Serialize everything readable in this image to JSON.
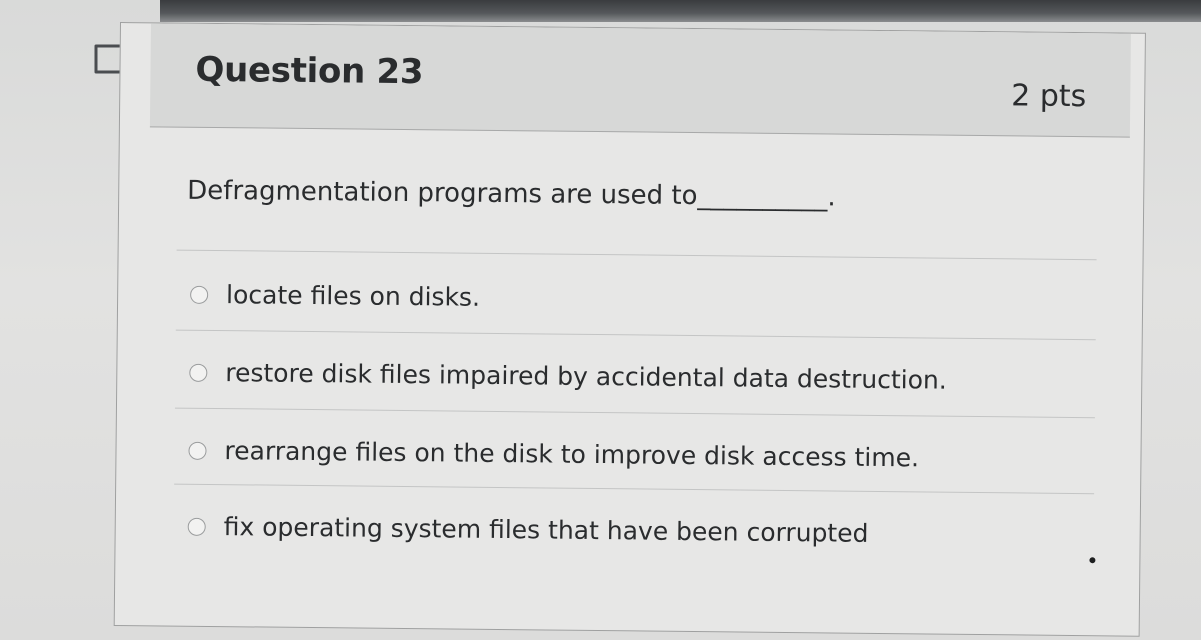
{
  "question": {
    "title": "Question 23",
    "points": "2 pts",
    "text": "Defragmentation programs are used to__________.",
    "answers": [
      "locate files on disks.",
      "restore disk files impaired by accidental data destruction.",
      "rearrange files on the disk to improve disk access time.",
      "fix operating system files that have been corrupted"
    ]
  },
  "colors": {
    "header_bg": "#d7d8d7",
    "card_bg": "#e7e7e6",
    "text": "#2a2c2e"
  }
}
